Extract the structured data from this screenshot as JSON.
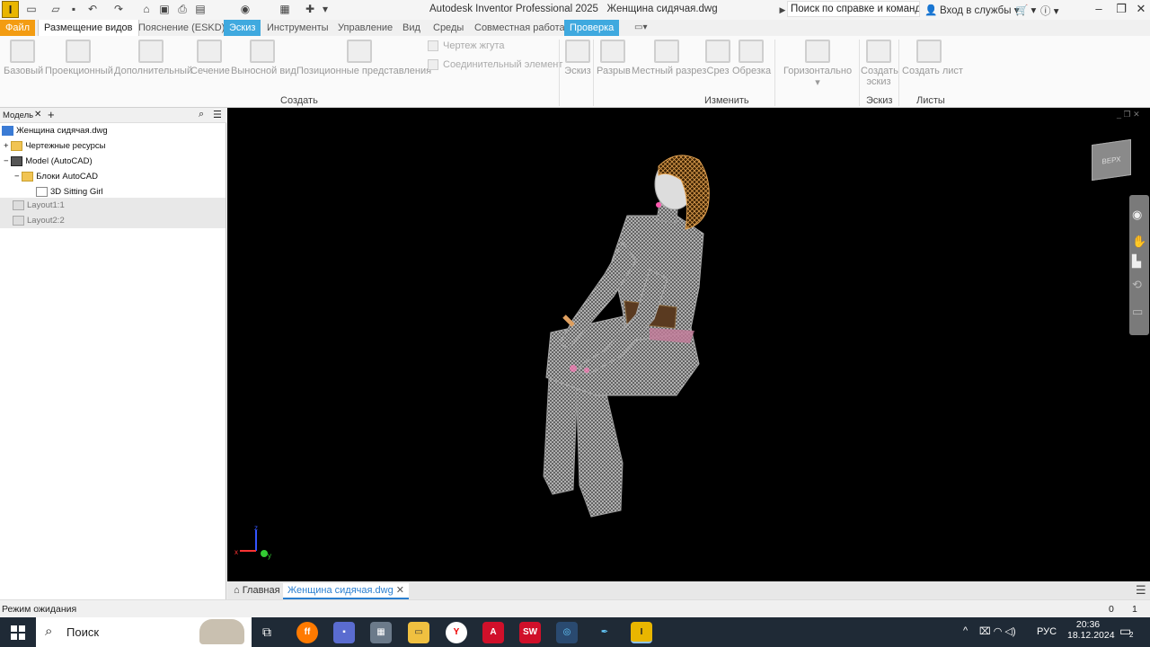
{
  "app": {
    "logo_letter": "I",
    "title": "Autodesk Inventor Professional 2025",
    "document_title": "Женщина сидячая.dwg",
    "search_placeholder": "Поиск по справке и командам",
    "sign_in": "Вход в службы"
  },
  "tabs": [
    {
      "label": "Файл",
      "style": "file"
    },
    {
      "label": "Размещение видов",
      "style": "active"
    },
    {
      "label": "Пояснение (ESKD)",
      "style": ""
    },
    {
      "label": "Эскиз",
      "style": "blue"
    },
    {
      "label": "Инструменты",
      "style": ""
    },
    {
      "label": "Управление",
      "style": ""
    },
    {
      "label": "Вид",
      "style": ""
    },
    {
      "label": "Среды",
      "style": ""
    },
    {
      "label": "Совместная работа",
      "style": ""
    },
    {
      "label": "Проверка",
      "style": "blue"
    }
  ],
  "ribbon": {
    "create": {
      "buttons": [
        "Базовый",
        "Проекционный",
        "Дополнительный",
        "Сечение",
        "Выносной вид",
        "Позиционные представления"
      ],
      "small": [
        "Чертеж жгута",
        "Соединительный элемент"
      ],
      "label": "Создать"
    },
    "sketch_btn": "Эскиз",
    "modify": {
      "buttons": [
        "Разрыв",
        "Местный разрез",
        "Срез",
        "Обрезка"
      ],
      "label": "Изменить"
    },
    "horizontal": "Горизонтально",
    "create_sketch": {
      "line1": "Создать",
      "line2": "эскиз",
      "label": "Эскиз"
    },
    "create_sheet": {
      "label_btn": "Создать лист",
      "label": "Листы"
    }
  },
  "browser": {
    "tab_label": "Модель",
    "tree": [
      {
        "label": "Женщина сидячая.dwg",
        "indent": 0,
        "expander": ""
      },
      {
        "label": "Чертежные ресурсы",
        "indent": 1,
        "expander": "+"
      },
      {
        "label": "Model (AutoCAD)",
        "indent": 1,
        "expander": "−"
      },
      {
        "label": "Блоки AutoCAD",
        "indent": 2,
        "expander": "−"
      },
      {
        "label": "3D Sitting Girl",
        "indent": 3,
        "expander": ""
      },
      {
        "label": "Layout1:1",
        "indent": 1,
        "expander": ""
      },
      {
        "label": "Layout2:2",
        "indent": 1,
        "expander": ""
      }
    ]
  },
  "viewcube_label": "ВЕРХ",
  "doc_tabs": {
    "home": "Главная",
    "doc": "Женщина сидячая.dwg"
  },
  "status": {
    "text": "Режим ожидания",
    "num1": "0",
    "num2": "1"
  },
  "taskbar": {
    "search": "Поиск",
    "lang": "РУС",
    "time": "20:36",
    "date": "18.12.2024",
    "notif": "2"
  },
  "colors": {
    "accent_orange": "#f39c12",
    "accent_blue": "#3fa9df",
    "taskbar": "#1f2a36",
    "viewport": "#000000"
  }
}
